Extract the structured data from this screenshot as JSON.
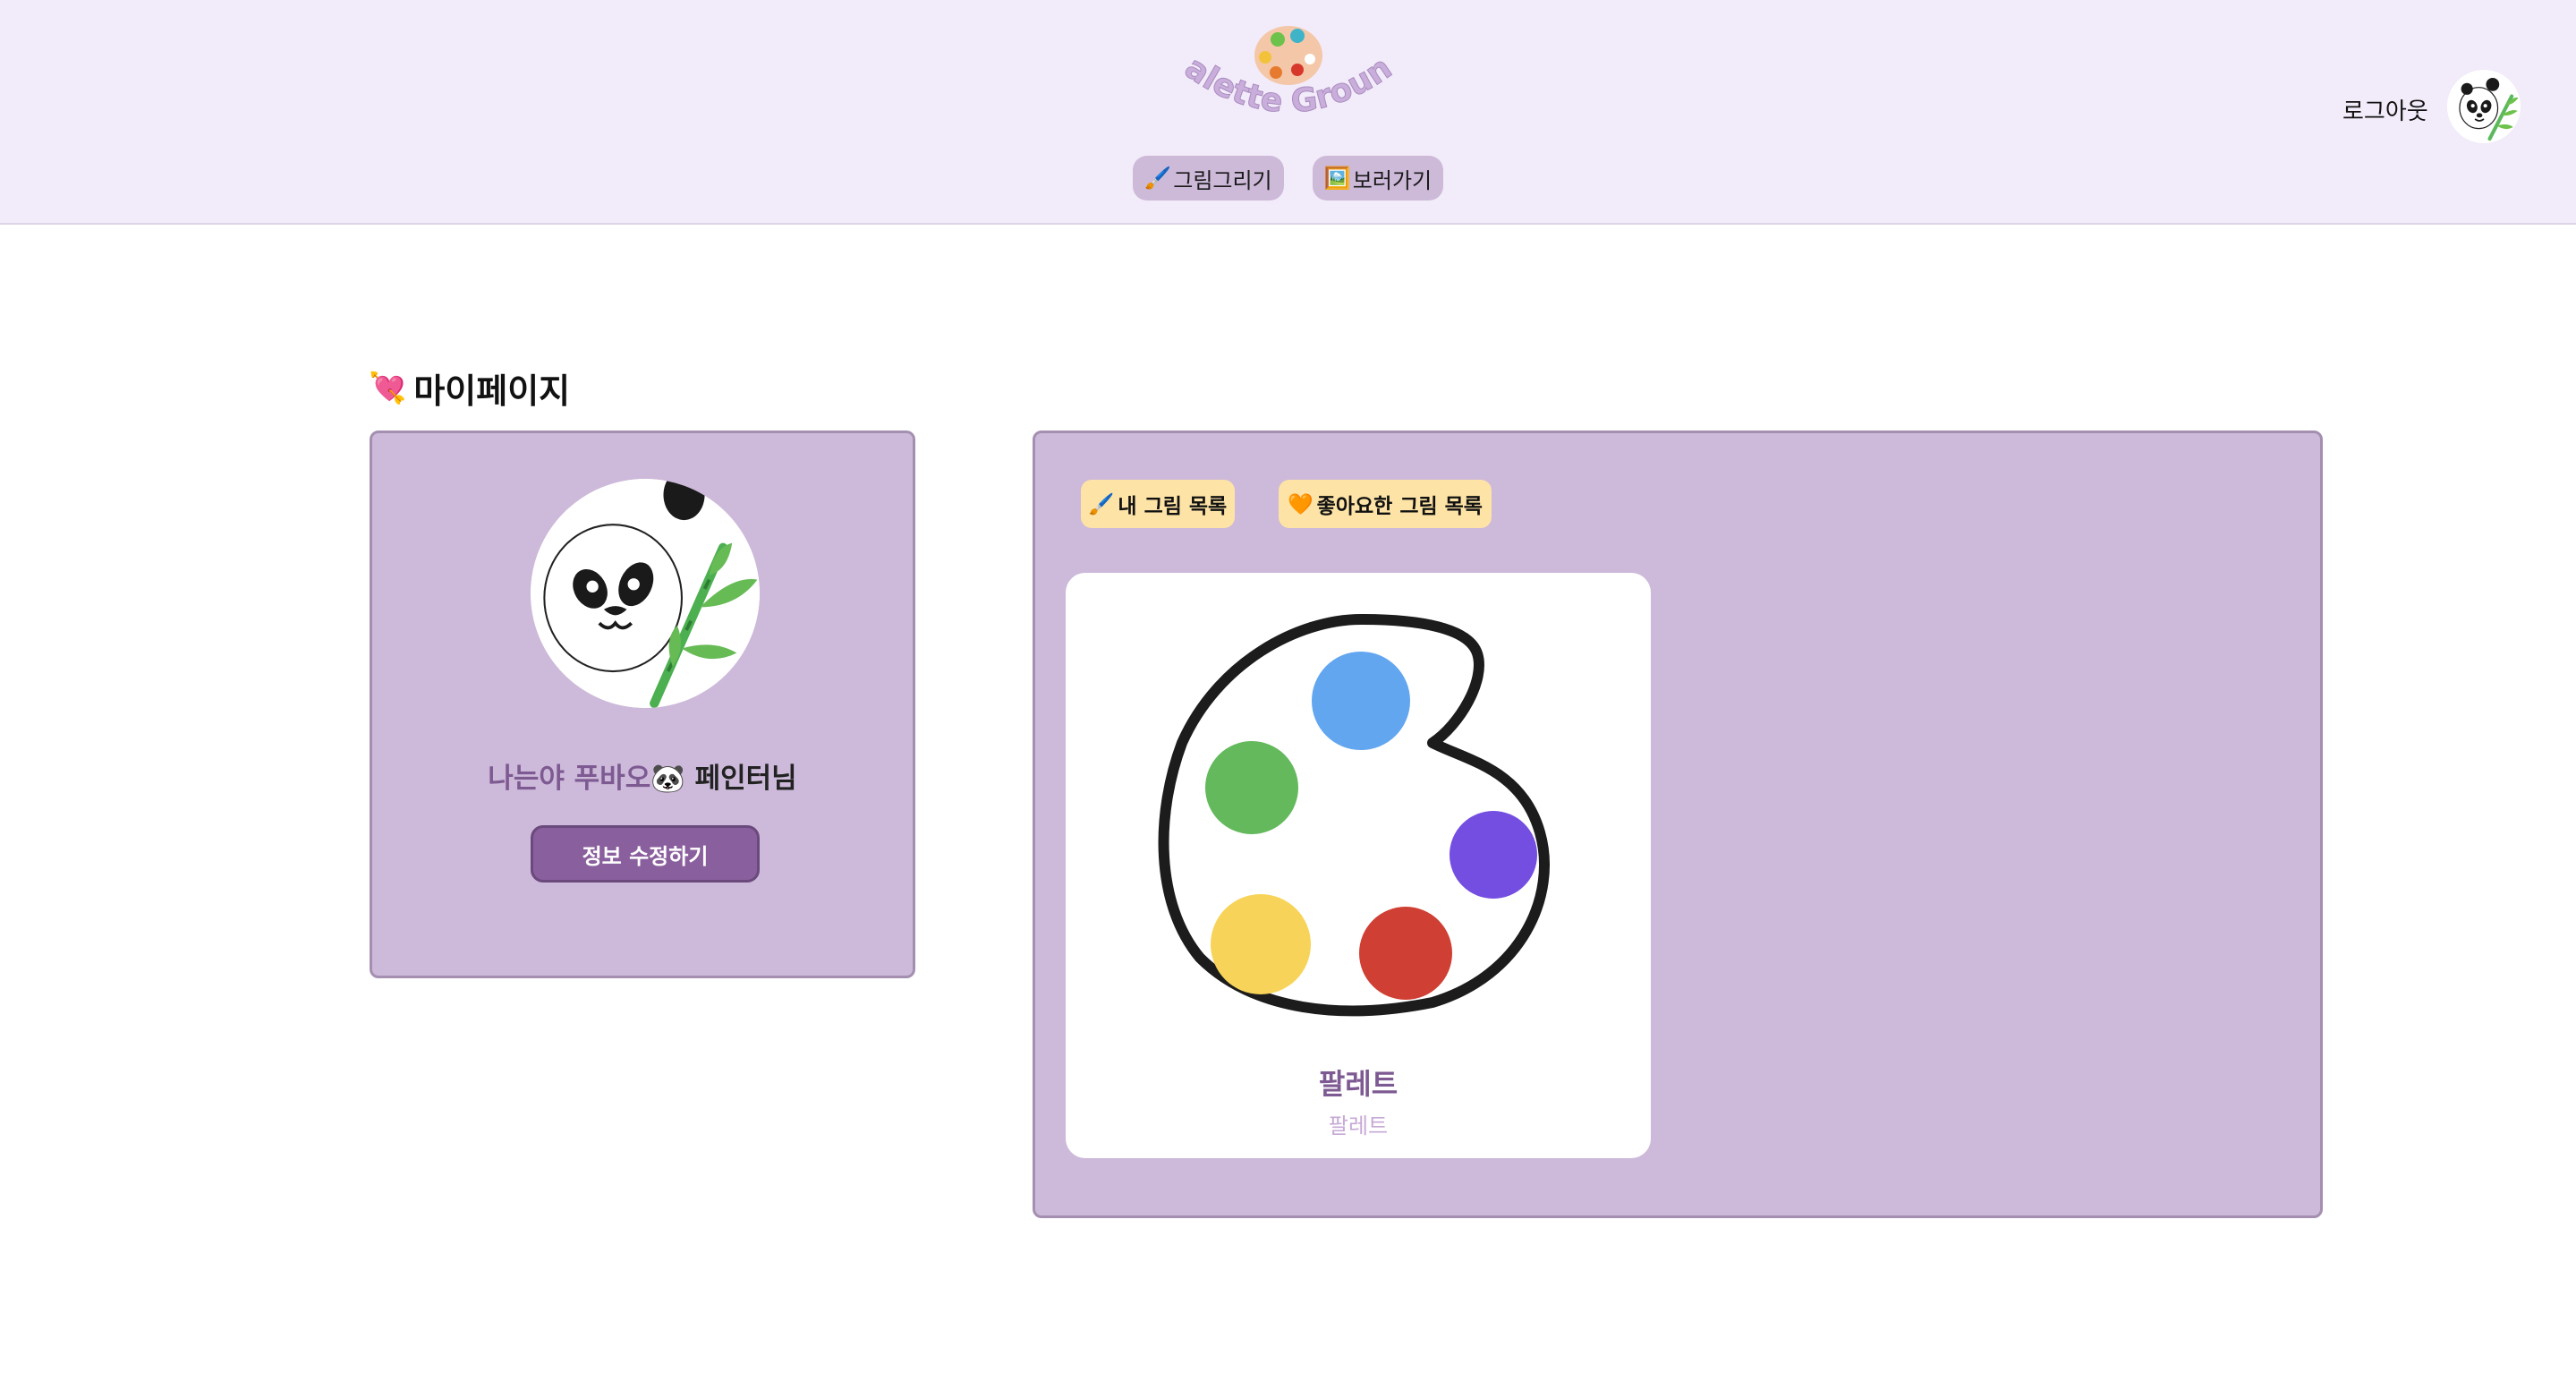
{
  "header": {
    "logo_text": "Palette Ground",
    "nav": [
      {
        "icon": "brush-icon",
        "emoji": "🖌️",
        "label": "그림그리기"
      },
      {
        "icon": "picture-icon",
        "emoji": "🖼️",
        "label": "보러가기"
      }
    ],
    "logout_label": "로그아웃"
  },
  "page": {
    "title_emoji": "💘",
    "title": "마이페이지"
  },
  "profile": {
    "nickname": "나는야 푸바오🐼",
    "suffix": " 페인터님",
    "edit_button": "정보 수정하기"
  },
  "gallery": {
    "tabs": [
      {
        "emoji": "🖌️",
        "label": "내 그림 목록"
      },
      {
        "emoji": "🧡",
        "label": "좋아요한 그림 목록"
      }
    ],
    "artworks": [
      {
        "title": "팔레트",
        "subtitle": "팔레트"
      }
    ]
  },
  "colors": {
    "header_bg": "#f2ebf9",
    "panel_bg": "#cdb9d9",
    "accent": "#8a5f9d",
    "tab_bg": "#fde3a6"
  }
}
